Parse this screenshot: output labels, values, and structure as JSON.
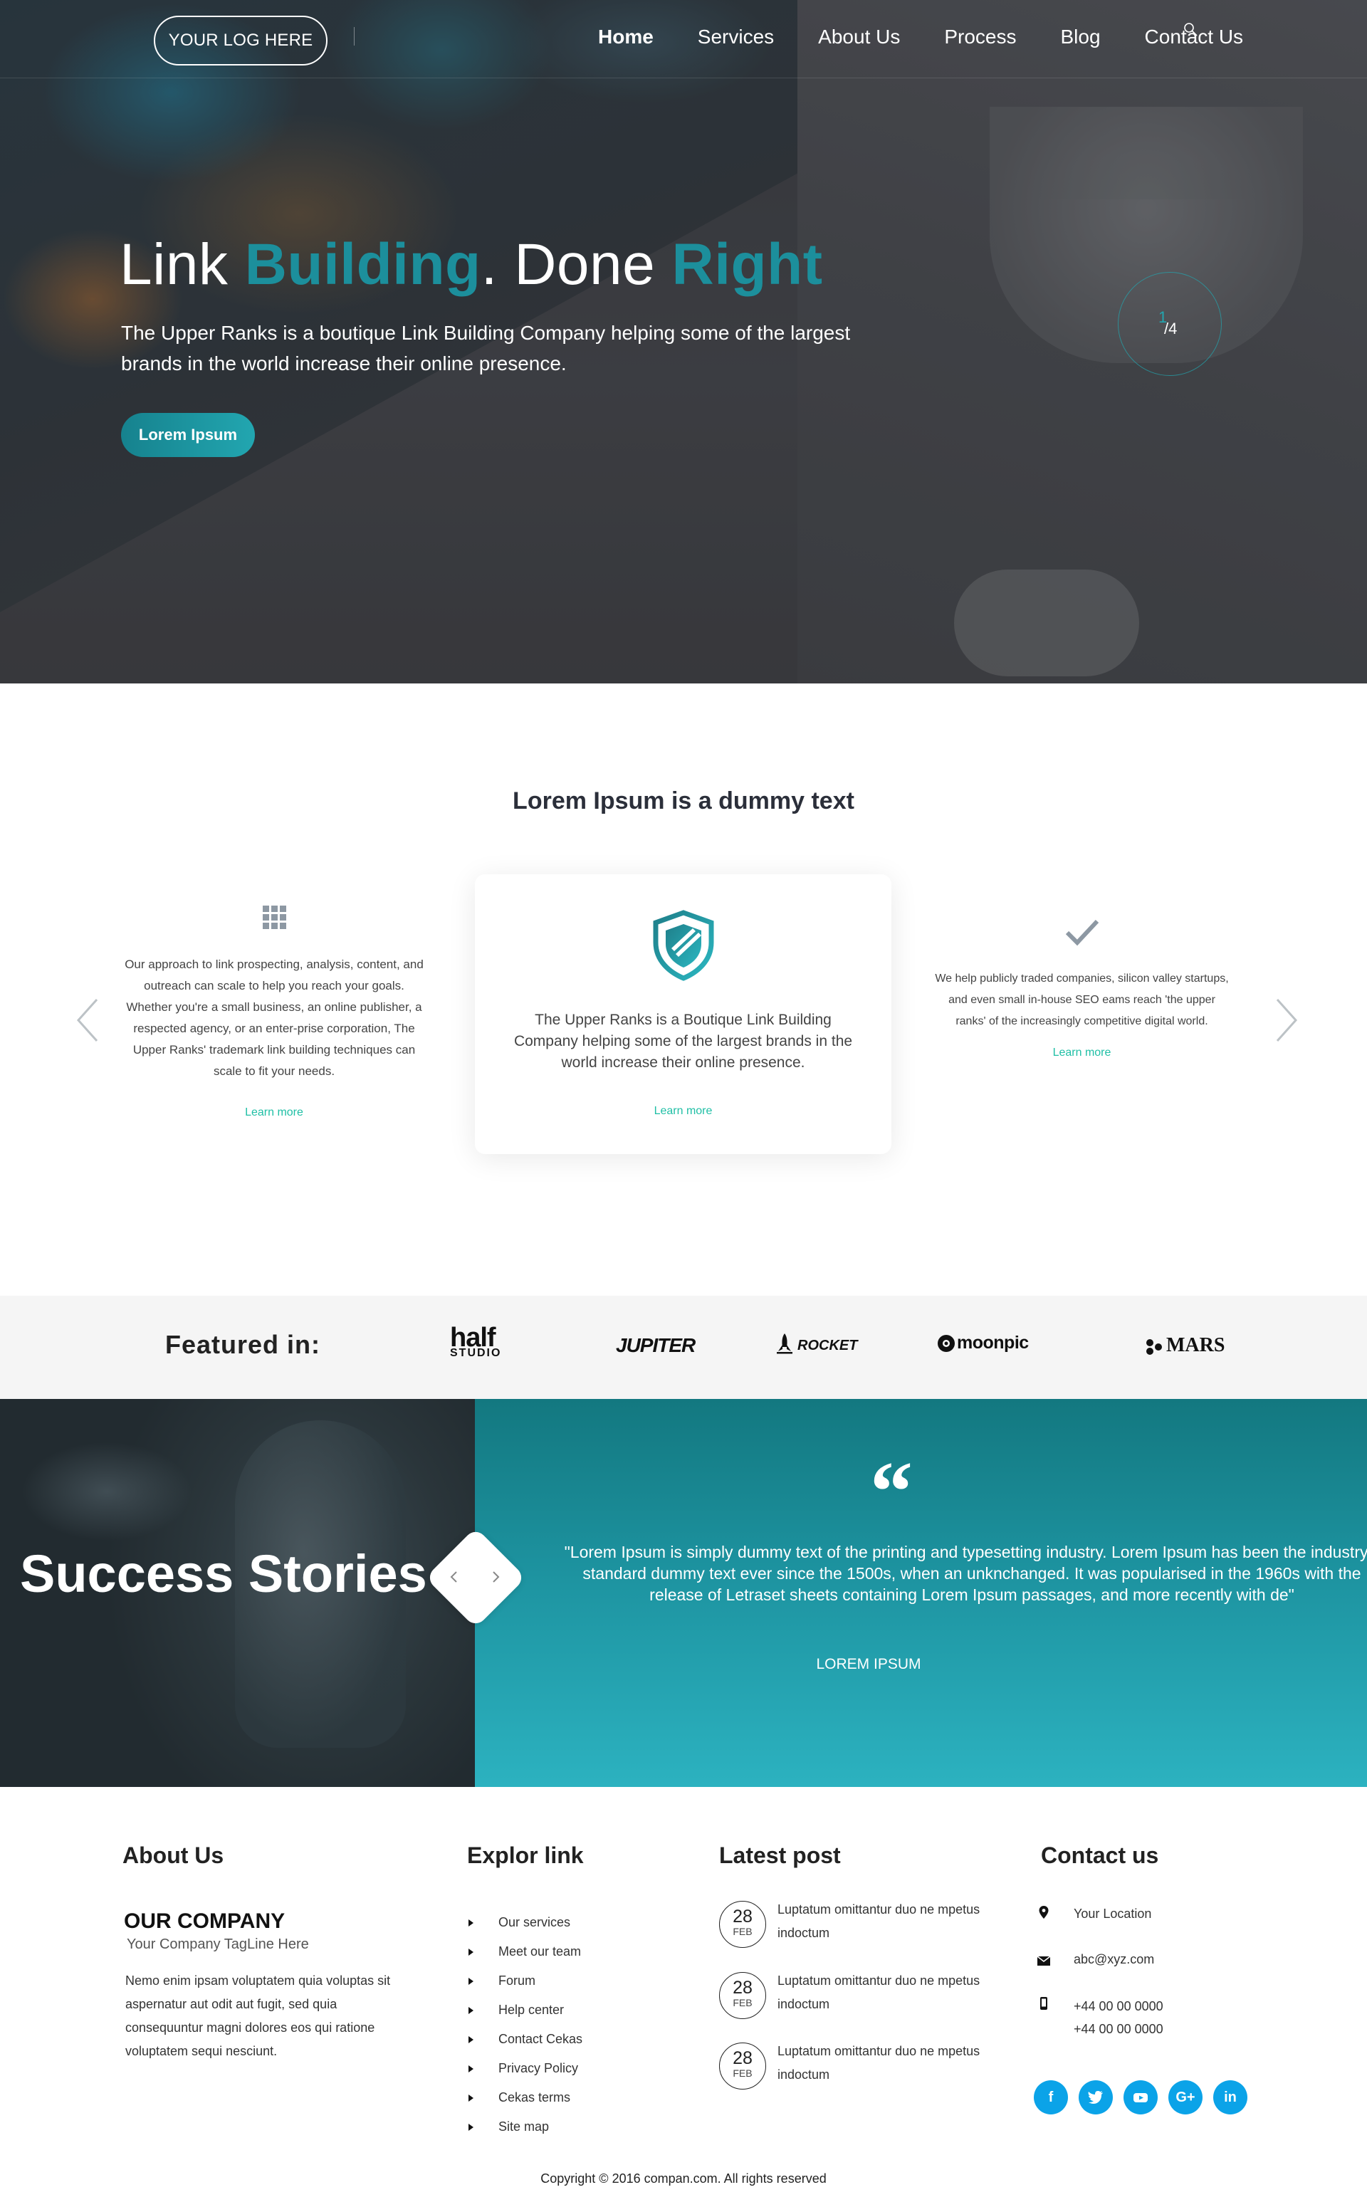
{
  "header": {
    "logo": "YOUR LOG HERE",
    "nav": [
      "Home",
      "Services",
      "About Us",
      "Process",
      "Blog",
      "Contact Us"
    ],
    "active_nav": "Home"
  },
  "hero": {
    "title_parts": [
      "Link ",
      "Building",
      ". Done ",
      "Right"
    ],
    "text": "The Upper Ranks is a boutique Link Building Company helping some of the largest brands in the world increase their online presence.",
    "button": "Lorem Ipsum",
    "slide_current": "1",
    "slide_total": "/4",
    "accent_color": "#1c8f9c"
  },
  "features": {
    "title": "Lorem Ipsum is a dummy text",
    "items": [
      {
        "icon": "grid-icon",
        "text": "Our approach to link prospecting, analysis, content, and outreach can scale to help you reach your goals. Whether you're a small business, an online publisher, a respected agency, or an enter-prise corporation, The Upper Ranks' trademark link building techniques can scale to fit your needs.",
        "link": "Learn more"
      },
      {
        "icon": "shield-icon",
        "text": "The Upper Ranks is a Boutique Link Building Company helping some of the largest brands in the world increase their online presence.",
        "link": "Learn more"
      },
      {
        "icon": "checkmark-icon",
        "text": "We help publicly traded companies, silicon valley startups, and even small in-house SEO eams reach 'the upper ranks' of the increasingly competitive digital world.",
        "link": "Learn more"
      }
    ]
  },
  "featured": {
    "label": "Featured in:",
    "brands": {
      "half": "half",
      "half_sub": "STUDIO",
      "jupiter": "JUPITER",
      "rocket": "ROCKET",
      "moonpic": "moonpic",
      "mars": "MARS"
    }
  },
  "success": {
    "title": "Success Stories",
    "quote": "\"Lorem Ipsum is simply dummy text of the printing and typesetting industry. Lorem Ipsum has been the industry's standard dummy text ever since the 1500s, when an unknchanged. It was popularised in the 1960s with the release of Letraset sheets containing Lorem Ipsum passages, and more recently with de\"",
    "author": "LOREM IPSUM"
  },
  "footer": {
    "about": {
      "heading": "About Us",
      "company": "OUR COMPANY",
      "tagline": "Your Company TagLine Here",
      "text": "Nemo enim ipsam voluptatem quia voluptas sit aspernatur aut odit aut fugit, sed quia consequuntur magni dolores eos qui ratione voluptatem sequi nesciunt."
    },
    "links": {
      "heading": "Explor link",
      "items": [
        "Our services",
        "Meet our team",
        "Forum",
        "Help center",
        "Contact Cekas",
        "Privacy Policy",
        "Cekas terms",
        "Site map"
      ]
    },
    "posts": {
      "heading": "Latest post",
      "items": [
        {
          "day": "28",
          "month": "FEB",
          "text": "Luptatum omittantur duo ne mpetus indoctum"
        },
        {
          "day": "28",
          "month": "FEB",
          "text": "Luptatum omittantur duo ne mpetus indoctum"
        },
        {
          "day": "28",
          "month": "FEB",
          "text": "Luptatum omittantur duo ne mpetus indoctum"
        }
      ]
    },
    "contact": {
      "heading": "Contact us",
      "location": "Your Location",
      "email": "abc@xyz.com",
      "phone1": "+44 00 00 0000",
      "phone2": "+44 00 00 0000",
      "social": [
        "f",
        "t",
        "yt",
        "G+",
        "in"
      ],
      "social_color": "#0ba3e8"
    },
    "copyright": "Copyright © 2016 compan.com. All rights reserved"
  }
}
